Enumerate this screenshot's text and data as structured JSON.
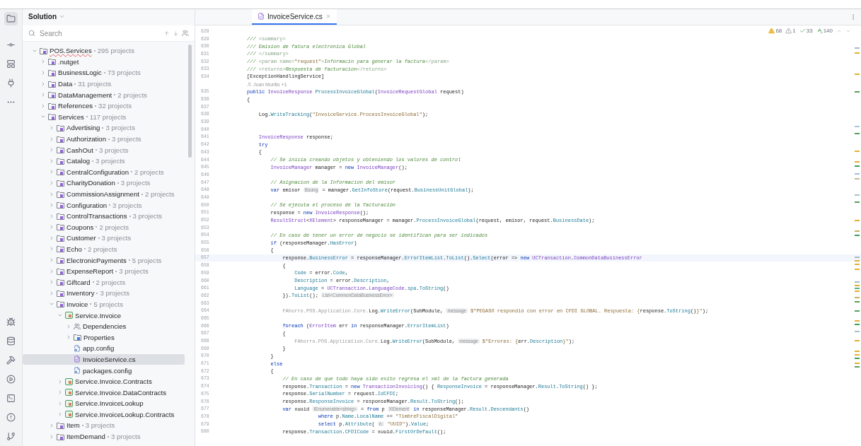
{
  "panel": {
    "title": "Solution"
  },
  "search": {
    "placeholder": "Search"
  },
  "tree": [
    {
      "name": "POS.Services",
      "count": "295 projects",
      "kind": "solution",
      "expanded": true,
      "selected": false,
      "children": [
        {
          "name": ".nutget",
          "kind": "folder",
          "expanded": false,
          "selected": false
        },
        {
          "name": "BusinessLogic",
          "count": "73 projects",
          "kind": "folder",
          "expanded": false,
          "selected": false
        },
        {
          "name": "Data",
          "count": "31 projects",
          "kind": "folder",
          "expanded": false,
          "selected": false
        },
        {
          "name": "DataManagement",
          "count": "2 projects",
          "kind": "folder",
          "expanded": false,
          "selected": false
        },
        {
          "name": "References",
          "count": "32 projects",
          "kind": "folder",
          "expanded": false,
          "selected": false
        },
        {
          "name": "Services",
          "count": "117 projects",
          "kind": "folder",
          "expanded": true,
          "selected": false,
          "children": [
            {
              "name": "Advertising",
              "count": "3 projects",
              "kind": "folder",
              "expanded": false,
              "selected": false
            },
            {
              "name": "Authorization",
              "count": "3 projects",
              "kind": "folder",
              "expanded": false,
              "selected": false
            },
            {
              "name": "CashOut",
              "count": "3 projects",
              "kind": "folder",
              "expanded": false,
              "selected": false
            },
            {
              "name": "Catalog",
              "count": "3 projects",
              "kind": "folder",
              "expanded": false,
              "selected": false
            },
            {
              "name": "CentralConfiguration",
              "count": "2 projects",
              "kind": "folder",
              "expanded": false,
              "selected": false
            },
            {
              "name": "CharityDonation",
              "count": "3 projects",
              "kind": "folder",
              "expanded": false,
              "selected": false
            },
            {
              "name": "CommissionAssignment",
              "count": "2 projects",
              "kind": "folder",
              "expanded": false,
              "selected": false
            },
            {
              "name": "Configuration",
              "count": "3 projects",
              "kind": "folder",
              "expanded": false,
              "selected": false
            },
            {
              "name": "ControlTransactions",
              "count": "3 projects",
              "kind": "folder",
              "expanded": false,
              "selected": false
            },
            {
              "name": "Coupons",
              "count": "2 projects",
              "kind": "folder",
              "expanded": false,
              "selected": false
            },
            {
              "name": "Customer",
              "count": "3 projects",
              "kind": "folder",
              "expanded": false,
              "selected": false
            },
            {
              "name": "Echo",
              "count": "2 projects",
              "kind": "folder",
              "expanded": false,
              "selected": false
            },
            {
              "name": "ElectronicPayments",
              "count": "5 projects",
              "kind": "folder",
              "expanded": false,
              "selected": false
            },
            {
              "name": "ExpenseReport",
              "count": "3 projects",
              "kind": "folder",
              "expanded": false,
              "selected": false
            },
            {
              "name": "Giftcard",
              "count": "2 projects",
              "kind": "folder",
              "expanded": false,
              "selected": false
            },
            {
              "name": "Inventory",
              "count": "3 projects",
              "kind": "folder",
              "expanded": false,
              "selected": false
            },
            {
              "name": "Invoice",
              "count": "5 projects",
              "kind": "folder",
              "expanded": true,
              "selected": false,
              "children": [
                {
                  "name": "Service.Invoice",
                  "kind": "project",
                  "expanded": true,
                  "selected": false,
                  "children": [
                    {
                      "name": "Dependencies",
                      "kind": "dependencies",
                      "expanded": false,
                      "selected": false
                    },
                    {
                      "name": "Properties",
                      "kind": "properties",
                      "expanded": false,
                      "selected": false
                    },
                    {
                      "name": "app.config",
                      "kind": "config",
                      "selected": false
                    },
                    {
                      "name": "InvoiceService.cs",
                      "kind": "csharp",
                      "selected": true
                    },
                    {
                      "name": "packages.config",
                      "kind": "config",
                      "selected": false
                    }
                  ]
                },
                {
                  "name": "Service.Invoice.Contracts",
                  "kind": "project",
                  "expanded": false,
                  "selected": false
                },
                {
                  "name": "Service.Invoice.DataContracts",
                  "kind": "project",
                  "expanded": false,
                  "selected": false
                },
                {
                  "name": "Service.InvoiceLookup",
                  "kind": "project",
                  "expanded": false,
                  "selected": false
                },
                {
                  "name": "Service.InvoiceLookup.Contracts",
                  "kind": "project",
                  "expanded": false,
                  "selected": false
                }
              ]
            },
            {
              "name": "Item",
              "count": "3 projects",
              "kind": "folder",
              "expanded": false,
              "selected": false
            },
            {
              "name": "ItemDemand",
              "count": "3 projects",
              "kind": "folder",
              "expanded": false,
              "selected": false
            }
          ]
        }
      ]
    }
  ],
  "tabs": [
    {
      "label": "InvoiceService.cs",
      "selected": true
    }
  ],
  "inspections": [
    {
      "kind": "warning",
      "count": "68"
    },
    {
      "kind": "weak",
      "count": "1"
    },
    {
      "kind": "ok",
      "count": "33"
    },
    {
      "kind": "typo",
      "count": "140"
    }
  ],
  "code": {
    "lines": [
      {
        "kind": "code",
        "number": "628",
        "current": false
      },
      {
        "kind": "code",
        "number": "629",
        "current": false,
        "segments": [
          {
            "kind": "doc",
            "text": "/// "
          },
          {
            "kind": "tag",
            "text": "<summary>"
          }
        ]
      },
      {
        "kind": "code",
        "number": "630",
        "current": false,
        "segments": [
          {
            "kind": "doc",
            "text": "/// Emision de fatura electronica Global"
          }
        ]
      },
      {
        "kind": "code",
        "number": "631",
        "current": false,
        "segments": [
          {
            "kind": "doc",
            "text": "/// "
          },
          {
            "kind": "tag",
            "text": "</summary>"
          }
        ]
      },
      {
        "kind": "code",
        "number": "632",
        "current": false,
        "segments": [
          {
            "kind": "doc",
            "text": "/// "
          },
          {
            "kind": "tag",
            "text": "<param name="
          },
          {
            "kind": "string",
            "text": "\"request\""
          },
          {
            "kind": "tag",
            "text": ">"
          },
          {
            "kind": "doc",
            "text": "Informacin para generar la factura"
          },
          {
            "kind": "tag",
            "text": "</param>"
          }
        ]
      },
      {
        "kind": "code",
        "number": "633",
        "current": false,
        "segments": [
          {
            "kind": "doc",
            "text": "/// "
          },
          {
            "kind": "tag",
            "text": "<returns>"
          },
          {
            "kind": "doc",
            "text": "Respuesta de facturacion"
          },
          {
            "kind": "tag",
            "text": "</returns>"
          }
        ]
      },
      {
        "kind": "code",
        "number": "634",
        "current": false,
        "segments": [
          {
            "kind": "plain",
            "text": "[ExceptionHandlingService]"
          }
        ]
      },
      {
        "kind": "author",
        "current": false,
        "segments": [
          {
            "kind": "hint",
            "text": "Juan Murillo +1"
          }
        ]
      },
      {
        "kind": "code",
        "number": "635",
        "current": false,
        "segments": [
          {
            "kind": "keyword",
            "text": "public "
          },
          {
            "kind": "type",
            "text": "InvoiceResponse "
          },
          {
            "kind": "member",
            "text": "ProcessInvoiceGlobal"
          },
          {
            "kind": "plain",
            "text": "("
          },
          {
            "kind": "type",
            "text": "InvoiceRequestGlobal"
          },
          {
            "kind": "plain",
            "text": " request)"
          }
        ]
      },
      {
        "kind": "code",
        "number": "636",
        "current": false,
        "segments": [
          {
            "kind": "plain",
            "text": "{"
          }
        ]
      },
      {
        "kind": "code",
        "number": "637",
        "current": false
      },
      {
        "kind": "code",
        "number": "638",
        "current": false,
        "segments": [
          {
            "kind": "plain",
            "text": "    Log."
          },
          {
            "kind": "member",
            "text": "WriteTracking"
          },
          {
            "kind": "plain",
            "text": "("
          },
          {
            "kind": "string",
            "text": "\"InvoiceService.ProcessInvoiceGlobal\""
          },
          {
            "kind": "plain",
            "text": ");"
          }
        ]
      },
      {
        "kind": "code",
        "number": "639",
        "current": false
      },
      {
        "kind": "code",
        "number": "640",
        "current": false
      },
      {
        "kind": "code",
        "number": "641",
        "current": false,
        "segments": [
          {
            "kind": "type",
            "text": "    InvoiceResponse"
          },
          {
            "kind": "plain",
            "text": " response;"
          }
        ]
      },
      {
        "kind": "code",
        "number": "642",
        "current": false,
        "segments": [
          {
            "kind": "keyword",
            "text": "    try"
          }
        ]
      },
      {
        "kind": "code",
        "number": "643",
        "current": false,
        "segments": [
          {
            "kind": "plain",
            "text": "    {"
          }
        ]
      },
      {
        "kind": "code",
        "number": "644",
        "current": false,
        "segments": [
          {
            "kind": "comment",
            "text": "        // Se inicia creando objetos y obteniendo los valores de control"
          }
        ]
      },
      {
        "kind": "code",
        "number": "645",
        "current": false,
        "segments": [
          {
            "kind": "type",
            "text": "        InvoiceManager"
          },
          {
            "kind": "plain",
            "text": " manager = "
          },
          {
            "kind": "keyword",
            "text": "new "
          },
          {
            "kind": "type",
            "text": "InvoiceManager"
          },
          {
            "kind": "plain",
            "text": "();"
          }
        ]
      },
      {
        "kind": "code",
        "number": "646",
        "current": false
      },
      {
        "kind": "code",
        "number": "647",
        "current": false,
        "segments": [
          {
            "kind": "comment",
            "text": "        // Asignacion de la Informacion del emisor"
          }
        ]
      },
      {
        "kind": "code",
        "number": "648",
        "current": false,
        "segments": [
          {
            "kind": "keyword",
            "text": "        var"
          },
          {
            "kind": "plain",
            "text": " emisor "
          },
          {
            "kind": "hint",
            "text": "Bsung"
          },
          {
            "kind": "plain",
            "text": " = manager."
          },
          {
            "kind": "member",
            "text": "GetInfoStore"
          },
          {
            "kind": "plain",
            "text": "(request."
          },
          {
            "kind": "member",
            "text": "BusinessUnitGlobal"
          },
          {
            "kind": "plain",
            "text": ");"
          }
        ]
      },
      {
        "kind": "code",
        "number": "649",
        "current": false
      },
      {
        "kind": "code",
        "number": "650",
        "current": false,
        "segments": [
          {
            "kind": "comment",
            "text": "        // Se ejecuta el proceso de la facturación"
          }
        ]
      },
      {
        "kind": "code",
        "number": "651",
        "current": false,
        "segments": [
          {
            "kind": "plain",
            "text": "        response = "
          },
          {
            "kind": "keyword",
            "text": "new "
          },
          {
            "kind": "type",
            "text": "InvoiceResponse"
          },
          {
            "kind": "plain",
            "text": "();"
          }
        ]
      },
      {
        "kind": "code",
        "number": "652",
        "current": false,
        "segments": [
          {
            "kind": "type",
            "text": "        ResultStruct"
          },
          {
            "kind": "plain",
            "text": "<"
          },
          {
            "kind": "type",
            "text": "XElement"
          },
          {
            "kind": "plain",
            "text": "> responseManager = manager."
          },
          {
            "kind": "member",
            "text": "ProcessInvoiceGlobal"
          },
          {
            "kind": "plain",
            "text": "(request, emisor, request."
          },
          {
            "kind": "member",
            "text": "BusinessDate"
          },
          {
            "kind": "plain",
            "text": ");"
          }
        ]
      },
      {
        "kind": "code",
        "number": "653",
        "current": false
      },
      {
        "kind": "code",
        "number": "654",
        "current": false,
        "segments": [
          {
            "kind": "comment",
            "text": "        // En caso de tener un error de negocio se identifican para ser indicados"
          }
        ]
      },
      {
        "kind": "code",
        "number": "655",
        "current": false,
        "segments": [
          {
            "kind": "keyword",
            "text": "        if"
          },
          {
            "kind": "plain",
            "text": " (responseManager."
          },
          {
            "kind": "member",
            "text": "HasError"
          },
          {
            "kind": "plain",
            "text": ")"
          }
        ]
      },
      {
        "kind": "code",
        "number": "656",
        "current": false,
        "segments": [
          {
            "kind": "plain",
            "text": "        {"
          }
        ]
      },
      {
        "kind": "code",
        "number": "657",
        "current": true,
        "segments": [
          {
            "kind": "plain",
            "text": "            response."
          },
          {
            "kind": "member",
            "text": "BusinessError"
          },
          {
            "kind": "plain",
            "text": " = responseManager."
          },
          {
            "kind": "member",
            "text": "ErrorItemList"
          },
          {
            "kind": "plain",
            "text": "."
          },
          {
            "kind": "member",
            "text": "ToList"
          },
          {
            "kind": "plain",
            "text": "()."
          },
          {
            "kind": "member",
            "text": "Select"
          },
          {
            "kind": "plain",
            "text": "(error => "
          },
          {
            "kind": "keyword",
            "text": "new "
          },
          {
            "kind": "type",
            "text": "UCTransaction"
          },
          {
            "kind": "plain",
            "text": "."
          },
          {
            "kind": "type",
            "text": "CommonDataBusinessError"
          }
        ]
      },
      {
        "kind": "code",
        "number": "658",
        "current": false,
        "segments": [
          {
            "kind": "plain",
            "text": "            {"
          }
        ]
      },
      {
        "kind": "code",
        "number": "659",
        "current": false,
        "segments": [
          {
            "kind": "member",
            "text": "                Code"
          },
          {
            "kind": "plain",
            "text": " = error."
          },
          {
            "kind": "member",
            "text": "Code"
          },
          {
            "kind": "plain",
            "text": ","
          }
        ]
      },
      {
        "kind": "code",
        "number": "660",
        "current": false,
        "segments": [
          {
            "kind": "member",
            "text": "                Description"
          },
          {
            "kind": "plain",
            "text": " = error."
          },
          {
            "kind": "member",
            "text": "Description"
          },
          {
            "kind": "plain",
            "text": ","
          }
        ]
      },
      {
        "kind": "code",
        "number": "661",
        "current": false,
        "segments": [
          {
            "kind": "member",
            "text": "                Language"
          },
          {
            "kind": "plain",
            "text": " = "
          },
          {
            "kind": "type",
            "text": "UCTransaction"
          },
          {
            "kind": "plain",
            "text": "."
          },
          {
            "kind": "type",
            "text": "LanguageCode"
          },
          {
            "kind": "plain",
            "text": "."
          },
          {
            "kind": "member",
            "text": "spa"
          },
          {
            "kind": "plain",
            "text": "."
          },
          {
            "kind": "member",
            "text": "ToString"
          },
          {
            "kind": "plain",
            "text": "()"
          }
        ]
      },
      {
        "kind": "code",
        "number": "662",
        "current": false,
        "segments": [
          {
            "kind": "plain",
            "text": "            })."
          },
          {
            "kind": "member",
            "text": "ToList"
          },
          {
            "kind": "plain",
            "text": "(); "
          },
          {
            "kind": "hint",
            "text": "List<CommonDataBusinessError>"
          }
        ]
      },
      {
        "kind": "code",
        "number": "663",
        "current": false
      },
      {
        "kind": "code",
        "number": "664",
        "current": false,
        "segments": [
          {
            "kind": "dim",
            "text": "            FAhorro.POS.Application.Core."
          },
          {
            "kind": "plain",
            "text": "Log."
          },
          {
            "kind": "member",
            "text": "WriteError"
          },
          {
            "kind": "plain",
            "text": "(SubModule, "
          },
          {
            "kind": "hint",
            "text": "message"
          },
          {
            "kind": "string",
            "text": " $\"PEGASO respondió con error en CFDI GLOBAL. Respuesta: {"
          },
          {
            "kind": "plain",
            "text": "response."
          },
          {
            "kind": "member",
            "text": "ToString"
          },
          {
            "kind": "plain",
            "text": "()"
          },
          {
            "kind": "string",
            "text": "}\""
          },
          {
            "kind": "plain",
            "text": ");"
          }
        ]
      },
      {
        "kind": "code",
        "number": "665",
        "current": false
      },
      {
        "kind": "code",
        "number": "666",
        "current": false,
        "segments": [
          {
            "kind": "keyword",
            "text": "            foreach"
          },
          {
            "kind": "plain",
            "text": " ("
          },
          {
            "kind": "type",
            "text": "ErrorItem"
          },
          {
            "kind": "plain",
            "text": " err "
          },
          {
            "kind": "keyword",
            "text": "in"
          },
          {
            "kind": "plain",
            "text": " responseManager."
          },
          {
            "kind": "member",
            "text": "ErrorItemList"
          },
          {
            "kind": "plain",
            "text": ")"
          }
        ]
      },
      {
        "kind": "code",
        "number": "667",
        "current": false,
        "segments": [
          {
            "kind": "plain",
            "text": "            {"
          }
        ]
      },
      {
        "kind": "code",
        "number": "668",
        "current": false,
        "segments": [
          {
            "kind": "dim",
            "text": "                FAhorro.POS.Application.Core."
          },
          {
            "kind": "plain",
            "text": "Log."
          },
          {
            "kind": "member",
            "text": "WriteError"
          },
          {
            "kind": "plain",
            "text": "(SubModule, "
          },
          {
            "kind": "hint",
            "text": "message"
          },
          {
            "kind": "string",
            "text": " $\"Errores: {"
          },
          {
            "kind": "plain",
            "text": "err."
          },
          {
            "kind": "member",
            "text": "Description"
          },
          {
            "kind": "string",
            "text": "}\""
          },
          {
            "kind": "plain",
            "text": ");"
          }
        ]
      },
      {
        "kind": "code",
        "number": "669",
        "current": false,
        "segments": [
          {
            "kind": "plain",
            "text": "            }"
          }
        ]
      },
      {
        "kind": "code",
        "number": "670",
        "current": false,
        "segments": [
          {
            "kind": "plain",
            "text": "        }"
          }
        ]
      },
      {
        "kind": "code",
        "number": "671",
        "current": false,
        "segments": [
          {
            "kind": "keyword",
            "text": "        else"
          }
        ]
      },
      {
        "kind": "code",
        "number": "672",
        "current": false,
        "segments": [
          {
            "kind": "plain",
            "text": "        {"
          }
        ]
      },
      {
        "kind": "code",
        "number": "673",
        "current": false,
        "segments": [
          {
            "kind": "comment",
            "text": "            // En caso de que todo haya sido exito regresa el xml de la factura generada"
          }
        ]
      },
      {
        "kind": "code",
        "number": "674",
        "current": false,
        "segments": [
          {
            "kind": "plain",
            "text": "            response."
          },
          {
            "kind": "member",
            "text": "Transaction"
          },
          {
            "kind": "plain",
            "text": " = "
          },
          {
            "kind": "keyword",
            "text": "new "
          },
          {
            "kind": "type",
            "text": "TransactionInvoicing"
          },
          {
            "kind": "plain",
            "text": "() { "
          },
          {
            "kind": "member",
            "text": "ResponseInvoice"
          },
          {
            "kind": "plain",
            "text": " = responseManager."
          },
          {
            "kind": "member",
            "text": "Result"
          },
          {
            "kind": "plain",
            "text": "."
          },
          {
            "kind": "member",
            "text": "ToString"
          },
          {
            "kind": "plain",
            "text": "() };"
          }
        ]
      },
      {
        "kind": "code",
        "number": "675",
        "current": false,
        "segments": [
          {
            "kind": "plain",
            "text": "            response."
          },
          {
            "kind": "member",
            "text": "SerialNumber"
          },
          {
            "kind": "plain",
            "text": " = request."
          },
          {
            "kind": "member",
            "text": "IdCFDI"
          },
          {
            "kind": "plain",
            "text": ";"
          }
        ]
      },
      {
        "kind": "code",
        "number": "676",
        "current": false,
        "segments": [
          {
            "kind": "plain",
            "text": "            response."
          },
          {
            "kind": "member",
            "text": "ResponseInvoice"
          },
          {
            "kind": "plain",
            "text": " = responseManager."
          },
          {
            "kind": "member",
            "text": "Result"
          },
          {
            "kind": "plain",
            "text": "."
          },
          {
            "kind": "member",
            "text": "ToString"
          },
          {
            "kind": "plain",
            "text": "();"
          }
        ]
      },
      {
        "kind": "code",
        "number": "677",
        "current": false,
        "segments": [
          {
            "kind": "keyword",
            "text": "            var"
          },
          {
            "kind": "plain",
            "text": " xuuid "
          },
          {
            "kind": "hint",
            "text": "IEnumerable<string>"
          },
          {
            "kind": "plain",
            "text": " = "
          },
          {
            "kind": "keyword",
            "text": "from"
          },
          {
            "kind": "plain",
            "text": " p "
          },
          {
            "kind": "hint",
            "text": "XElement"
          },
          {
            "kind": "keyword",
            "text": " in"
          },
          {
            "kind": "plain",
            "text": " responseManager."
          },
          {
            "kind": "member",
            "text": "Result"
          },
          {
            "kind": "plain",
            "text": "."
          },
          {
            "kind": "member",
            "text": "Descendants"
          },
          {
            "kind": "plain",
            "text": "()"
          }
        ]
      },
      {
        "kind": "code",
        "number": "678",
        "current": false,
        "segments": [
          {
            "kind": "keyword",
            "text": "                        where"
          },
          {
            "kind": "plain",
            "text": " p."
          },
          {
            "kind": "member",
            "text": "Name"
          },
          {
            "kind": "plain",
            "text": "."
          },
          {
            "kind": "member",
            "text": "LocalName"
          },
          {
            "kind": "plain",
            "text": " == "
          },
          {
            "kind": "string",
            "text": "\"TimbreFiscalDigital\""
          }
        ]
      },
      {
        "kind": "code",
        "number": "679",
        "current": false,
        "segments": [
          {
            "kind": "keyword",
            "text": "                        select"
          },
          {
            "kind": "plain",
            "text": " p."
          },
          {
            "kind": "member",
            "text": "Attribute"
          },
          {
            "kind": "plain",
            "text": "( "
          },
          {
            "kind": "hint",
            "text": "n:"
          },
          {
            "kind": "string",
            "text": " \"UUID\""
          },
          {
            "kind": "plain",
            "text": ")."
          },
          {
            "kind": "member",
            "text": "Value"
          },
          {
            "kind": "plain",
            "text": ";"
          }
        ]
      },
      {
        "kind": "code",
        "number": "680",
        "current": false,
        "segments": [
          {
            "kind": "plain",
            "text": "            response."
          },
          {
            "kind": "member",
            "text": "Transaction"
          },
          {
            "kind": "plain",
            "text": "."
          },
          {
            "kind": "member",
            "text": "CFDICode"
          },
          {
            "kind": "plain",
            "text": " = xuuid."
          },
          {
            "kind": "member",
            "text": "FirstOrDefault"
          },
          {
            "kind": "plain",
            "text": "();"
          }
        ]
      }
    ]
  }
}
